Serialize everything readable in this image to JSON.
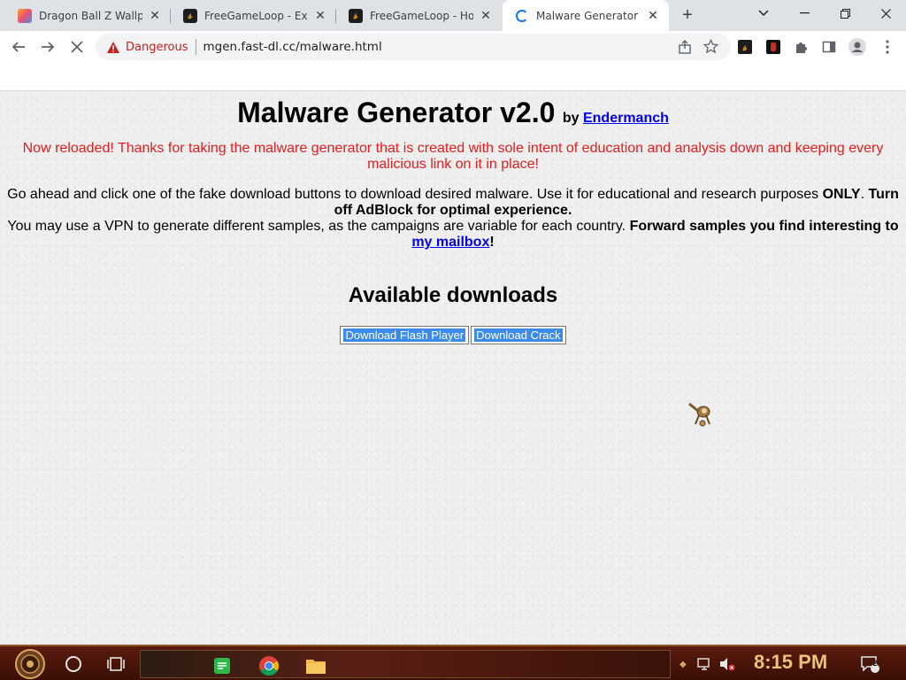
{
  "tabs": [
    {
      "title": "Dragon Ball Z Wallpap",
      "favicon": "dragonball-favicon",
      "active": false
    },
    {
      "title": "FreeGameLoop - Expl",
      "favicon": "freegameloop-favicon",
      "active": false
    },
    {
      "title": "FreeGameLoop - Hom",
      "favicon": "freegameloop-favicon",
      "active": false
    },
    {
      "title": "Malware Generator",
      "favicon": "loading-spinner",
      "active": true
    }
  ],
  "omnibox": {
    "security_label": "Dangerous",
    "url": "mgen.fast-dl.cc/malware.html"
  },
  "page": {
    "heading": "Malware Generator v2.0",
    "by_label": "by",
    "author_link": "Endermanch",
    "notice": "Now reloaded! Thanks for taking the malware generator that is created with sole intent of education and analysis down and keeping every malicious link on it in place!",
    "info_line1_a": "Go ahead and click one of the fake download buttons to download desired malware. Use it for educational and research purposes ",
    "info_line1_bold1": "ONLY",
    "info_line1_b": ". ",
    "info_line1_bold2": "Turn off AdBlock for optimal experience.",
    "info_line2_a": "You may use a VPN to generate different samples, as the campaigns are variable for each country. ",
    "info_line2_bold": "Forward samples you find interesting to",
    "mailbox_link": "my mailbox",
    "info_line2_end": "!",
    "downloads_heading": "Available downloads",
    "buttons": [
      "Download Flash Player",
      "Download Crack"
    ]
  },
  "taskbar": {
    "clock": "8:15 PM",
    "notification_count": "2"
  },
  "colors": {
    "danger": "#c5221f",
    "notice_red": "#e81c1c",
    "link": "#0000ee",
    "button_highlight": "#3c8bea",
    "clock_gold": "#e8c27a"
  }
}
